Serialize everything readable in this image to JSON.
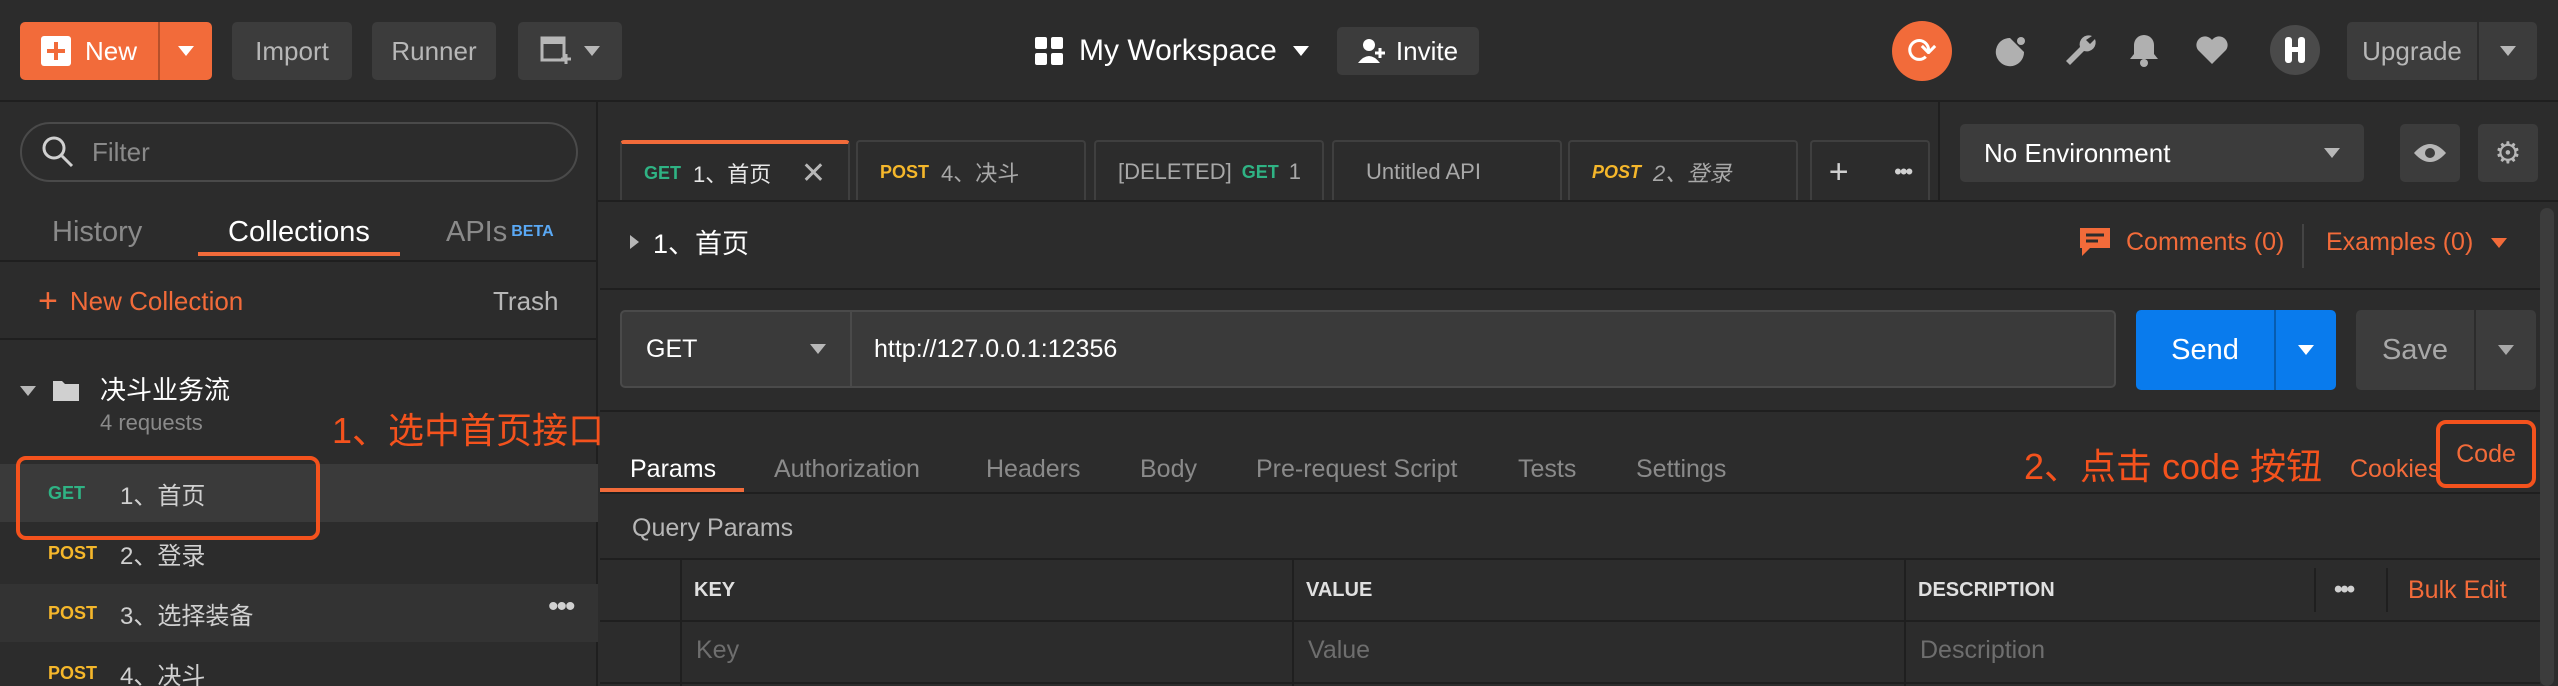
{
  "toolbar": {
    "new_label": "New",
    "import_label": "Import",
    "runner_label": "Runner",
    "workspace_label": "My Workspace",
    "invite_label": "Invite",
    "upgrade_label": "Upgrade"
  },
  "sidebar": {
    "filter_placeholder": "Filter",
    "tabs": [
      {
        "label": "History"
      },
      {
        "label": "Collections"
      },
      {
        "label": "APIs",
        "badge": "BETA"
      }
    ],
    "new_collection_label": "New Collection",
    "trash_label": "Trash",
    "collection": {
      "name": "决斗业务流",
      "count": "4 requests",
      "requests": [
        {
          "method": "GET",
          "name": "1、首页"
        },
        {
          "method": "POST",
          "name": "2、登录"
        },
        {
          "method": "POST",
          "name": "3、选择装备"
        },
        {
          "method": "POST",
          "name": "4、决斗"
        }
      ]
    }
  },
  "tabs": [
    {
      "method": "GET",
      "name": "1、首页"
    },
    {
      "method": "POST",
      "name": "4、决斗"
    },
    {
      "prefix": "[DELETED]",
      "method": "GET",
      "name": "1"
    },
    {
      "name": "Untitled API"
    },
    {
      "method": "POST",
      "name": "2、登录"
    }
  ],
  "environment": {
    "selected": "No Environment"
  },
  "request": {
    "name": "1、首页",
    "comments_label": "Comments (0)",
    "examples_label": "Examples (0)",
    "method": "GET",
    "url": "http://127.0.0.1:12356",
    "send_label": "Send",
    "save_label": "Save",
    "subtabs": [
      "Params",
      "Authorization",
      "Headers",
      "Body",
      "Pre-request Script",
      "Tests",
      "Settings"
    ],
    "cookies_label": "Cookies",
    "code_label": "Code",
    "query_params_title": "Query Params",
    "columns": {
      "key": "KEY",
      "value": "VALUE",
      "description": "DESCRIPTION"
    },
    "bulk_edit_label": "Bulk Edit",
    "placeholders": {
      "key": "Key",
      "value": "Value",
      "description": "Description"
    }
  },
  "annotations": {
    "step1": "1、选中首页接口",
    "step2": "2、点击 code 按钮"
  },
  "colors": {
    "accent": "#f26b3a",
    "send_blue": "#097bed",
    "annotation_red": "#f4521d",
    "get": "#2fb384",
    "post": "#f5b72b"
  }
}
